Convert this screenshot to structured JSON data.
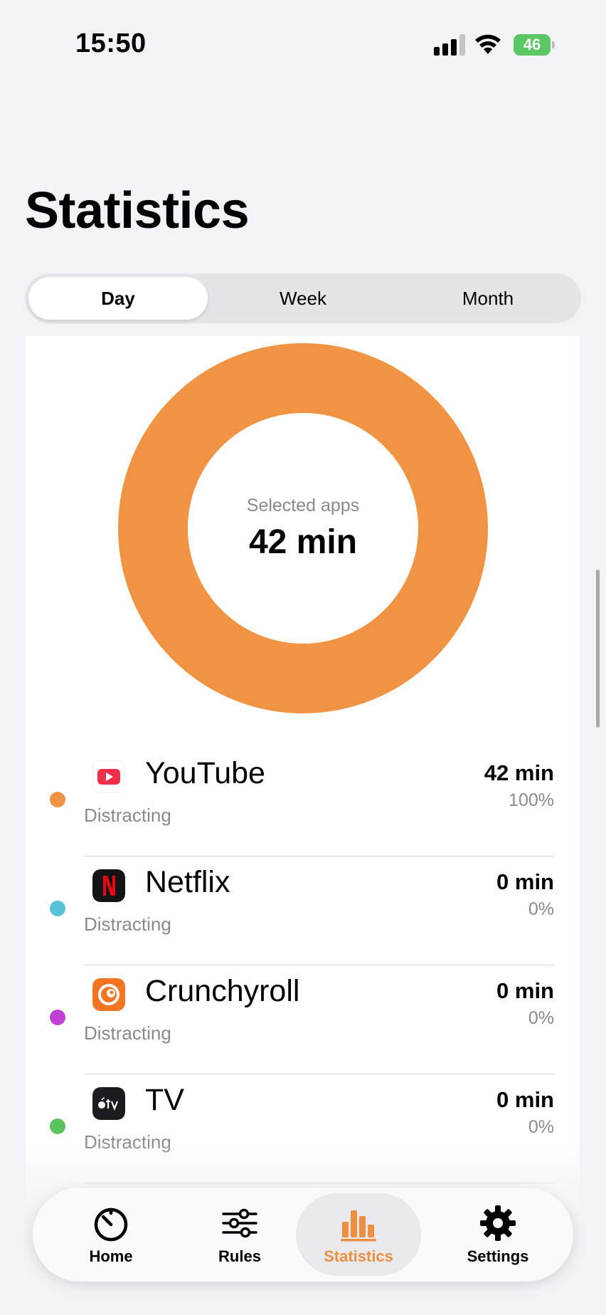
{
  "status_bar": {
    "time": "15:50",
    "battery": "46"
  },
  "page": {
    "title": "Statistics"
  },
  "segments": {
    "day": "Day",
    "week": "Week",
    "month": "Month",
    "selected": "Day"
  },
  "summary": {
    "label": "Selected apps",
    "value": "42 min",
    "ring_color": "#f09443"
  },
  "apps": [
    {
      "name": "YouTube",
      "category": "Distracting",
      "time": "42 min",
      "percent": "100%",
      "dot_color": "#ee9244",
      "icon": "youtube-icon"
    },
    {
      "name": "Netflix",
      "category": "Distracting",
      "time": "0 min",
      "percent": "0%",
      "dot_color": "#58c2d6",
      "icon": "netflix-icon"
    },
    {
      "name": "Crunchyroll",
      "category": "Distracting",
      "time": "0 min",
      "percent": "0%",
      "dot_color": "#c040d6",
      "icon": "crunchyroll-icon"
    },
    {
      "name": "TV",
      "category": "Distracting",
      "time": "0 min",
      "percent": "0%",
      "dot_color": "#5cc25e",
      "icon": "apple-tv-icon"
    }
  ],
  "tab_bar": {
    "home": "Home",
    "rules": "Rules",
    "statistics": "Statistics",
    "settings": "Settings",
    "active": "Statistics",
    "accent_color": "#ee8f3f"
  }
}
